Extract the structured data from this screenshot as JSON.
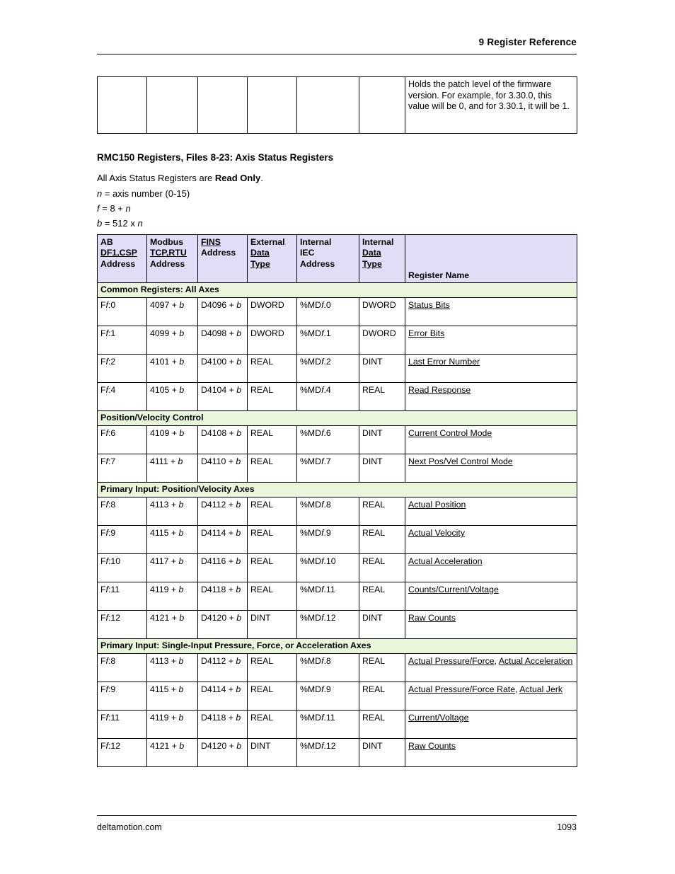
{
  "header": {
    "chapter": "9  Register Reference"
  },
  "continuation_cell": {
    "text": "Holds the patch level of the firmware version. For example, for 3.30.0, this value will be 0, and for 3.30.1, it will be 1."
  },
  "section": {
    "title": "RMC150 Registers, Files 8-23: Axis Status Registers",
    "line1_pre": "All Axis Status Registers are ",
    "line1_bold": "Read Only",
    "line1_post": ".",
    "line2_ital": "n",
    "line2_rest": " = axis number (0-15)",
    "line3_ital": "f",
    "line3_rest": " = 8 + ",
    "line3_ital2": "n",
    "line4_ital": "b",
    "line4_rest": " = 512 x ",
    "line4_ital2": "n"
  },
  "table": {
    "headers": [
      {
        "l1": "AB",
        "l2": "DF1",
        "l2b": ",CSP",
        "l3": "Address"
      },
      {
        "l1": "Modbus",
        "l2": "TCP",
        "l2b": ",RTU",
        "l3": "Address"
      },
      {
        "l1": "FINS",
        "l2": "Address"
      },
      {
        "l1": "External",
        "l2": "Data",
        "l3": "Type"
      },
      {
        "l1": "Internal",
        "l2": "IEC",
        "l3": "Address"
      },
      {
        "l1": "Internal",
        "l2": "Data",
        "l3": "Type"
      },
      {
        "l1": "Register Name"
      }
    ],
    "groups": [
      {
        "label": "Common Registers: All Axes",
        "rows": [
          {
            "ab": "F",
            "ab_i": "f",
            "ab_post": ":0",
            "modbus": "4097 + ",
            "modbus_i": "b",
            "fins": "D4096 + ",
            "fins_i": "b",
            "ext": "DWORD",
            "iec": "%MD",
            "iec_i": "f",
            "iec_post": ".0",
            "int": "DWORD",
            "name": "Status Bits"
          },
          {
            "ab": "F",
            "ab_i": "f",
            "ab_post": ":1",
            "modbus": "4099 + ",
            "modbus_i": "b",
            "fins": "D4098 + ",
            "fins_i": "b",
            "ext": "DWORD",
            "iec": "%MD",
            "iec_i": "f",
            "iec_post": ".1",
            "int": "DWORD",
            "name": "Error Bits"
          },
          {
            "ab": "F",
            "ab_i": "f",
            "ab_post": ":2",
            "modbus": "4101 + ",
            "modbus_i": "b",
            "fins": "D4100 + ",
            "fins_i": "b",
            "ext": "REAL",
            "iec": "%MD",
            "iec_i": "f",
            "iec_post": ".2",
            "int": "DINT",
            "name": "Last Error Number"
          },
          {
            "ab": "F",
            "ab_i": "f",
            "ab_post": ":4",
            "modbus": "4105 + ",
            "modbus_i": "b",
            "fins": "D4104 + ",
            "fins_i": "b",
            "ext": "REAL",
            "iec": "%MD",
            "iec_i": "f",
            "iec_post": ".4",
            "int": "REAL",
            "name": "Read Response"
          }
        ]
      },
      {
        "label": "Position/Velocity Control",
        "rows": [
          {
            "ab": "F",
            "ab_i": "f",
            "ab_post": ":6",
            "modbus": "4109 + ",
            "modbus_i": "b",
            "fins": "D4108 + ",
            "fins_i": "b",
            "ext": "REAL",
            "iec": "%MD",
            "iec_i": "f",
            "iec_post": ".6",
            "int": "DINT",
            "name": "Current Control Mode"
          },
          {
            "ab": "F",
            "ab_i": "f",
            "ab_post": ":7",
            "modbus": "4111 + ",
            "modbus_i": "b",
            "fins": "D4110 + ",
            "fins_i": "b",
            "ext": "REAL",
            "iec": "%MD",
            "iec_i": "f",
            "iec_post": ".7",
            "int": "DINT",
            "name": "Next Pos/Vel Control Mode"
          }
        ]
      },
      {
        "label": "Primary Input: Position/Velocity Axes",
        "rows": [
          {
            "ab": "F",
            "ab_i": "f",
            "ab_post": ":8",
            "modbus": "4113 + ",
            "modbus_i": "b",
            "fins": "D4112 + ",
            "fins_i": "b",
            "ext": "REAL",
            "iec": "%MD",
            "iec_i": "f",
            "iec_post": ".8",
            "int": "REAL",
            "name": "Actual Position"
          },
          {
            "ab": "F",
            "ab_i": "f",
            "ab_post": ":9",
            "modbus": "4115 + ",
            "modbus_i": "b",
            "fins": "D4114 + ",
            "fins_i": "b",
            "ext": "REAL",
            "iec": "%MD",
            "iec_i": "f",
            "iec_post": ".9",
            "int": "REAL",
            "name": "Actual Velocity"
          },
          {
            "ab": "F",
            "ab_i": "f",
            "ab_post": ":10",
            "modbus": "4117 + ",
            "modbus_i": "b",
            "fins": "D4116 + ",
            "fins_i": "b",
            "ext": "REAL",
            "iec": "%MD",
            "iec_i": "f",
            "iec_post": ".10",
            "int": "REAL",
            "name": "Actual Acceleration"
          },
          {
            "ab": "F",
            "ab_i": "f",
            "ab_post": ":11",
            "modbus": "4119 + ",
            "modbus_i": "b",
            "fins": "D4118 + ",
            "fins_i": "b",
            "ext": "REAL",
            "iec": "%MD",
            "iec_i": "f",
            "iec_post": ".11",
            "int": "REAL",
            "name": "Counts/Current/Voltage"
          },
          {
            "ab": "F",
            "ab_i": "f",
            "ab_post": ":12",
            "modbus": "4121 + ",
            "modbus_i": "b",
            "fins": "D4120 + ",
            "fins_i": "b",
            "ext": "DINT",
            "iec": "%MD",
            "iec_i": "f",
            "iec_post": ".12",
            "int": "DINT",
            "name": "Raw Counts"
          }
        ]
      },
      {
        "label": "Primary Input: Single-Input Pressure, Force, or Acceleration Axes",
        "rows": [
          {
            "ab": "F",
            "ab_i": "f",
            "ab_post": ":8",
            "modbus": "4113 + ",
            "modbus_i": "b",
            "fins": "D4112 + ",
            "fins_i": "b",
            "ext": "REAL",
            "iec": "%MD",
            "iec_i": "f",
            "iec_post": ".8",
            "int": "REAL",
            "name": "Actual Pressure/Force, Actual Acceleration"
          },
          {
            "ab": "F",
            "ab_i": "f",
            "ab_post": ":9",
            "modbus": "4115 + ",
            "modbus_i": "b",
            "fins": "D4114 + ",
            "fins_i": "b",
            "ext": "REAL",
            "iec": "%MD",
            "iec_i": "f",
            "iec_post": ".9",
            "int": "REAL",
            "name": "Actual Pressure/Force Rate, Actual Jerk"
          },
          {
            "ab": "F",
            "ab_i": "f",
            "ab_post": ":11",
            "modbus": "4119 + ",
            "modbus_i": "b",
            "fins": "D4118 + ",
            "fins_i": "b",
            "ext": "REAL",
            "iec": "%MD",
            "iec_i": "f",
            "iec_post": ".11",
            "int": "REAL",
            "name": "Current/Voltage"
          },
          {
            "ab": "F",
            "ab_i": "f",
            "ab_post": ":12",
            "modbus": "4121 + ",
            "modbus_i": "b",
            "fins": "D4120 + ",
            "fins_i": "b",
            "ext": "DINT",
            "iec": "%MD",
            "iec_i": "f",
            "iec_post": ".12",
            "int": "DINT",
            "name": "Raw Counts"
          }
        ]
      }
    ]
  },
  "footer": {
    "site": "deltamotion.com",
    "page": "1093"
  },
  "colors": {
    "header_fill": "#e2dcf7",
    "group_fill": "#eaf5dc",
    "border": "#000000"
  }
}
